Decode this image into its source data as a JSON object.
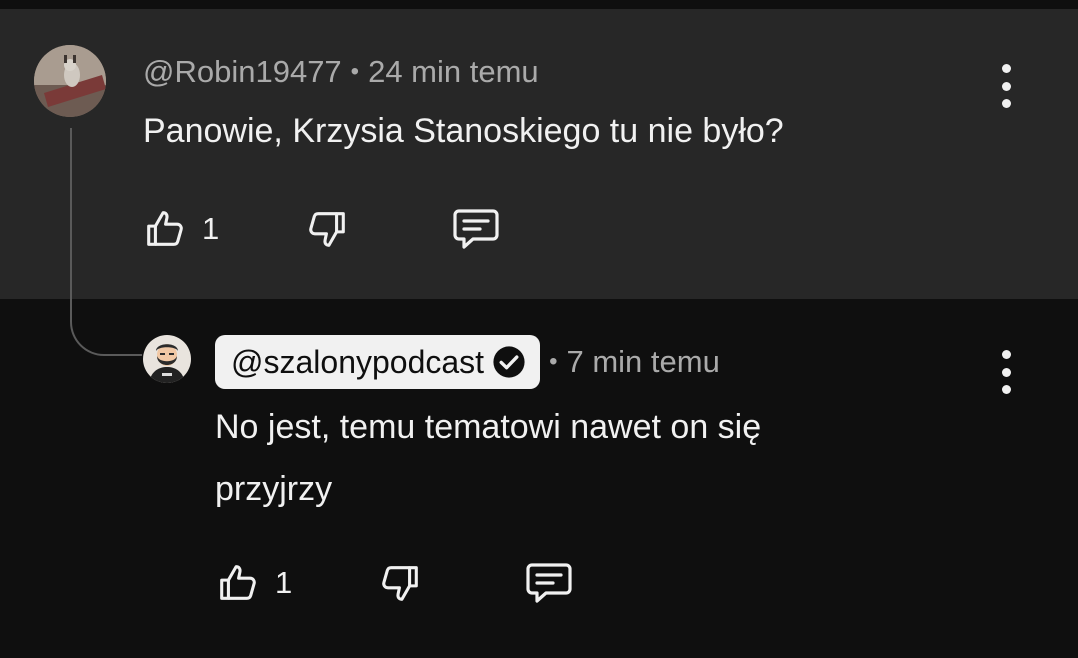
{
  "parent_comment": {
    "author": "@Robin19477",
    "separator": "•",
    "time": "24 min temu",
    "text": "Panowie, Krzysia Stanoskiego tu nie było?",
    "like_count": "1"
  },
  "reply_comment": {
    "author": "@szalonypodcast",
    "verified": true,
    "separator": "•",
    "time": "7 min temu",
    "text_line1": "No jest, temu tematowi nawet on się",
    "text_line2": "przyjrzy",
    "like_count": "1"
  },
  "icons": {
    "like": "thumbs-up-icon",
    "dislike": "thumbs-down-icon",
    "reply": "comment-icon",
    "more": "more-vertical-icon",
    "verified": "verified-check-icon"
  },
  "colors": {
    "parent_bg": "#272727",
    "reply_bg": "#0f0f0f",
    "text_primary": "#f1f1f1",
    "text_secondary": "#aaaaaa",
    "creator_chip_bg": "#f1f1f1"
  }
}
